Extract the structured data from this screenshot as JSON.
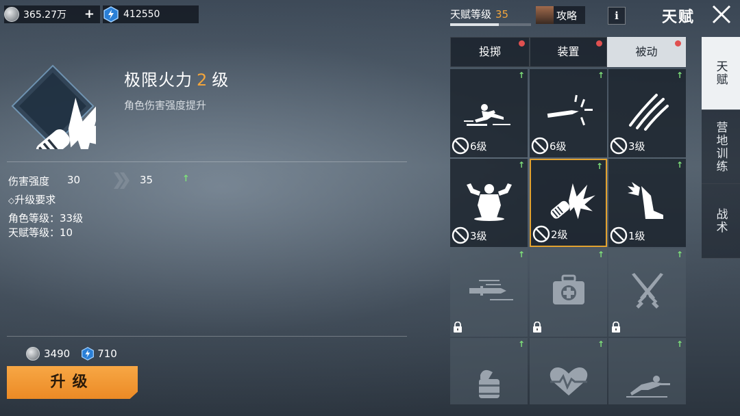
{
  "resources": {
    "silver": "365.27万",
    "plus": "+",
    "energy": "412550"
  },
  "talent_level": {
    "label": "天赋等级",
    "value": "35",
    "progress": 0.6
  },
  "guide_label": "攻略",
  "info_label": "i",
  "page_title": "天赋",
  "skill": {
    "name": "极限火力",
    "level": "2",
    "level_unit": "级",
    "desc": "角色伤害强度提升",
    "stat_label": "伤害强度",
    "stat_current": "30",
    "stat_next": "35",
    "req_title": "升级要求",
    "req_role": "角色等级：33级",
    "req_talent": "天赋等级：10"
  },
  "cost": {
    "silver": "3490",
    "energy": "710"
  },
  "upgrade_label": "升级",
  "tabs": [
    {
      "label": "投掷",
      "dot": true
    },
    {
      "label": "装置",
      "dot": true
    },
    {
      "label": "被动",
      "dot": true,
      "active": true
    }
  ],
  "grid": [
    {
      "icon": "slide-kick-icon",
      "level": "6级",
      "state": "disabled"
    },
    {
      "icon": "bullet-icon",
      "level": "6级",
      "state": "disabled"
    },
    {
      "icon": "claw-slash-icon",
      "level": "3级",
      "state": "disabled"
    },
    {
      "icon": "muscle-icon",
      "level": "3级",
      "state": "disabled"
    },
    {
      "icon": "firepower-icon",
      "level": "2级",
      "state": "selected"
    },
    {
      "icon": "winged-boot-icon",
      "level": "1级",
      "state": "disabled"
    },
    {
      "icon": "speed-knife-icon",
      "level": "",
      "state": "locked"
    },
    {
      "icon": "medkit-icon",
      "level": "",
      "state": "locked"
    },
    {
      "icon": "crossed-knives-icon",
      "level": "",
      "state": "locked"
    },
    {
      "icon": "canned-food-icon",
      "level": "",
      "state": "locked"
    },
    {
      "icon": "heartbeat-icon",
      "level": "",
      "state": "locked"
    },
    {
      "icon": "crawl-soldier-icon",
      "level": "",
      "state": "locked"
    }
  ],
  "side_tabs": [
    {
      "label": "天赋",
      "active": true
    },
    {
      "label": "营地训练",
      "active": false
    },
    {
      "label": "战术",
      "active": false
    }
  ],
  "colors": {
    "accent_orange": "#f2a53c",
    "upgrade_button": "#ec8a25",
    "up_arrow_green": "#7ee07a",
    "badge_red": "#e05050",
    "selected_border": "#e3a22f"
  }
}
